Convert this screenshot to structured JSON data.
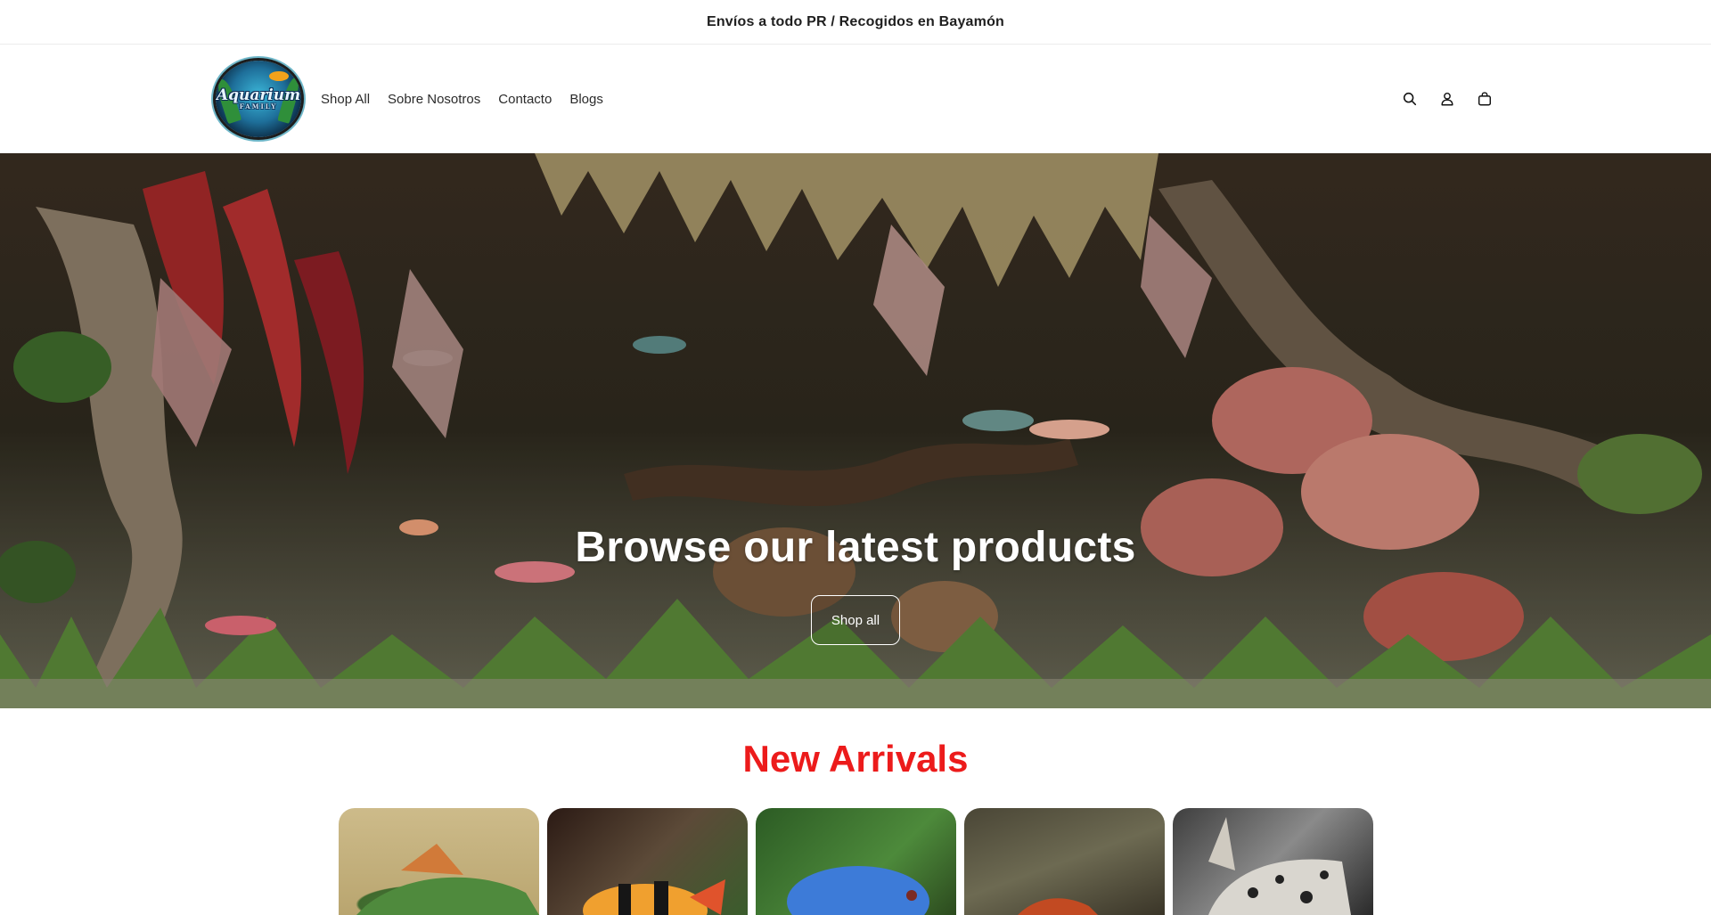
{
  "announcement": {
    "text": "Envíos a todo PR / Recogidos en Bayamón"
  },
  "header": {
    "logo": {
      "text_main": "Aquarium",
      "text_sub": "FAMILY"
    },
    "nav": [
      {
        "label": "Shop All"
      },
      {
        "label": "Sobre Nosotros"
      },
      {
        "label": "Contacto"
      },
      {
        "label": "Blogs"
      }
    ],
    "icons": [
      "search-icon",
      "account-icon",
      "cart-icon"
    ]
  },
  "hero": {
    "title": "Browse our latest products",
    "button_label": "Shop all"
  },
  "new_arrivals": {
    "title": "New Arrivals",
    "products": [
      {
        "image": "green-fish-image"
      },
      {
        "image": "clown-loach-image"
      },
      {
        "image": "blue-gourami-image"
      },
      {
        "image": "red-fish-image"
      },
      {
        "image": "spotted-catfish-image"
      }
    ]
  },
  "colors": {
    "accent_red": "#ec1b1b",
    "text_dark": "#121212"
  }
}
